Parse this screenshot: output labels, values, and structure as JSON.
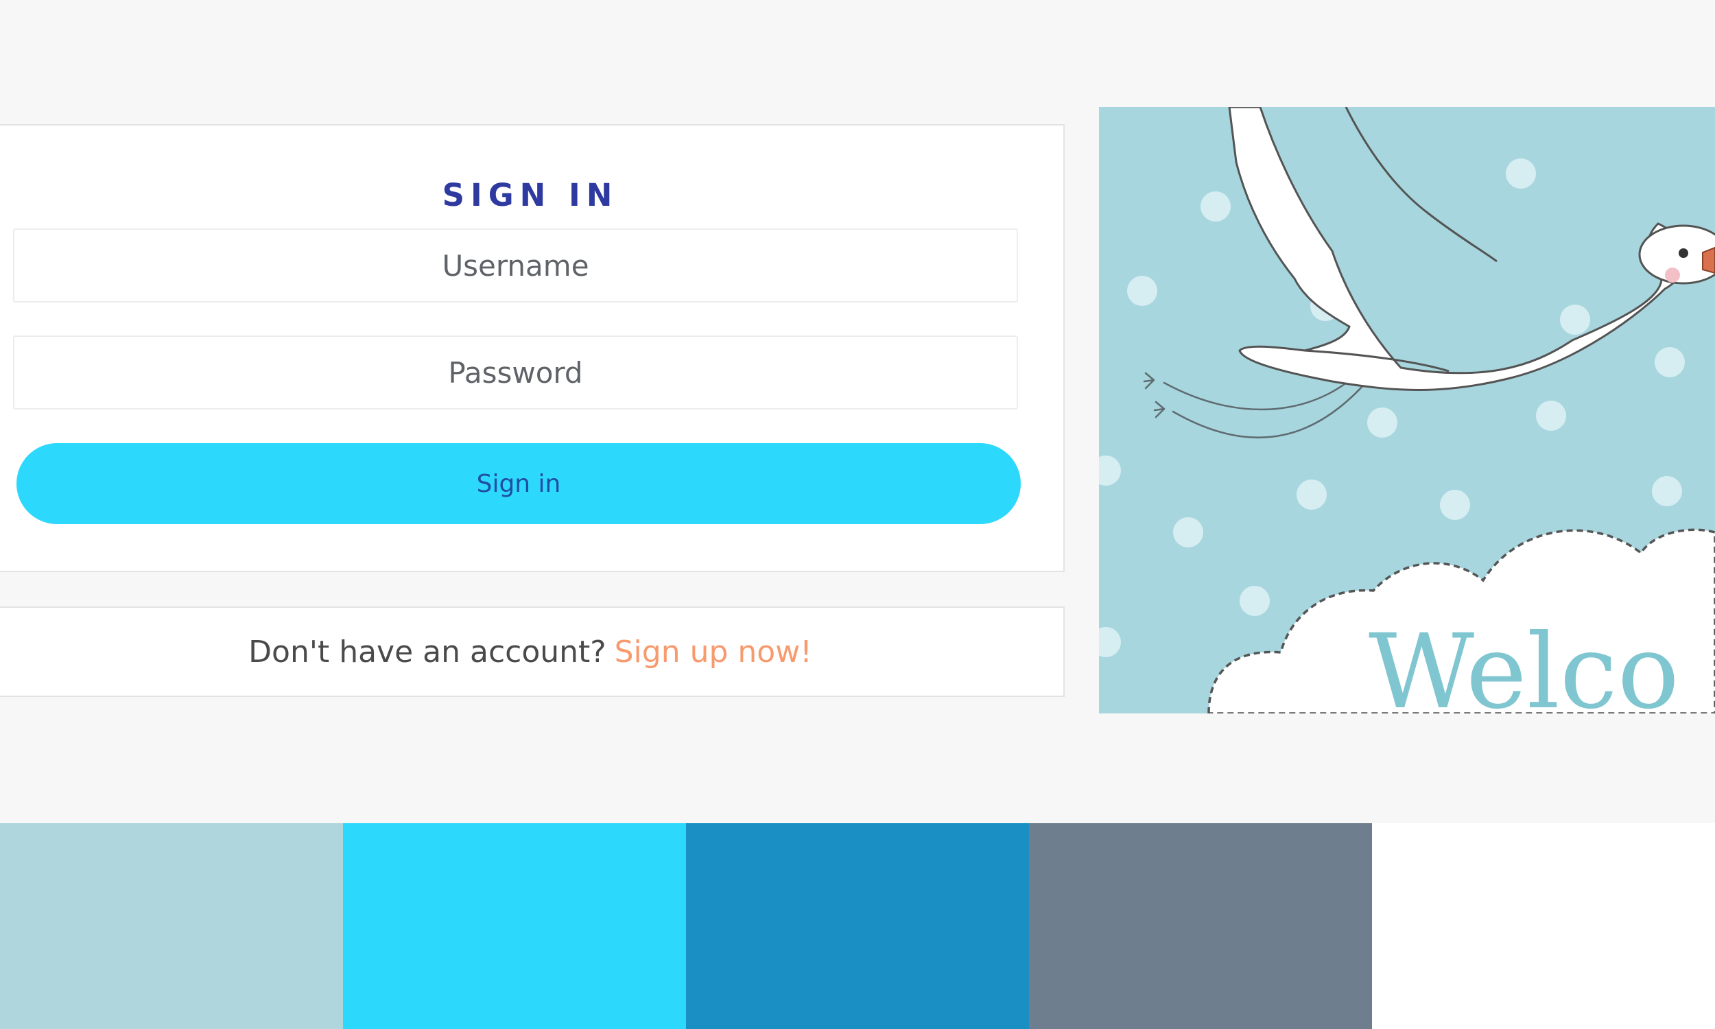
{
  "login": {
    "title": "SIGN IN",
    "username_placeholder": "Username",
    "password_placeholder": "Password",
    "submit_label": "Sign in"
  },
  "signup": {
    "prompt": "Don't have an account?",
    "link_label": "Sign up now!"
  },
  "welcome_image": {
    "icon": "stork-illustration",
    "visible_text": "Welco"
  },
  "palette": {
    "swatches": [
      "#aed6dc",
      "#2dd8fd",
      "#1a8fc4",
      "#6e7e8e",
      "#ffffff"
    ]
  },
  "colors": {
    "title": "#2e3a9f",
    "button_bg": "#2dd8fd",
    "button_text": "#1f4fa3",
    "link": "#f79a6d",
    "image_bg": "#a7d6de"
  }
}
